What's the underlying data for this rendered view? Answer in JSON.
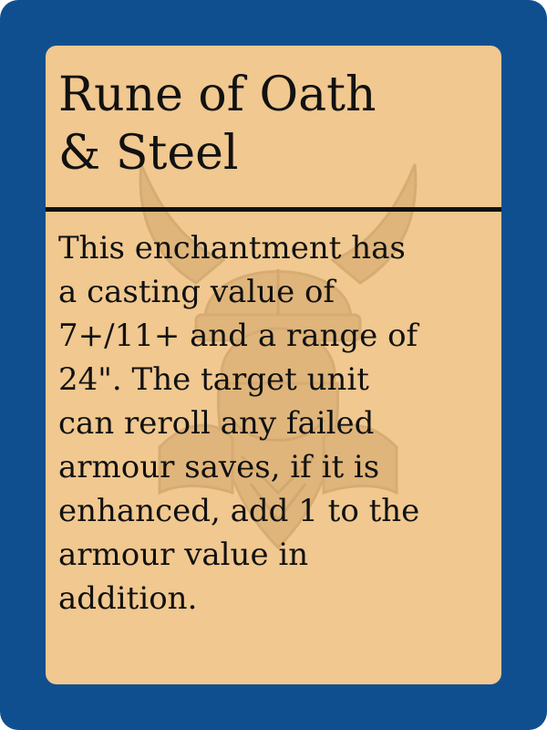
{
  "card": {
    "title_lines": [
      "Rune of Oath",
      "& Steel"
    ],
    "body_lines": [
      "This enchantment has",
      "a casting value of",
      "7+/11+ and a range of",
      "24\". The target unit",
      "can reroll any failed",
      "armour saves, if it is",
      "enhanced, add 1 to the",
      "armour value in",
      "addition."
    ],
    "background_image": "horned-dwarf-helmet-icon"
  },
  "colors": {
    "frame": "#0f4f8f",
    "face": "#f0c890",
    "text": "#111111",
    "watermark": "#b08040"
  }
}
